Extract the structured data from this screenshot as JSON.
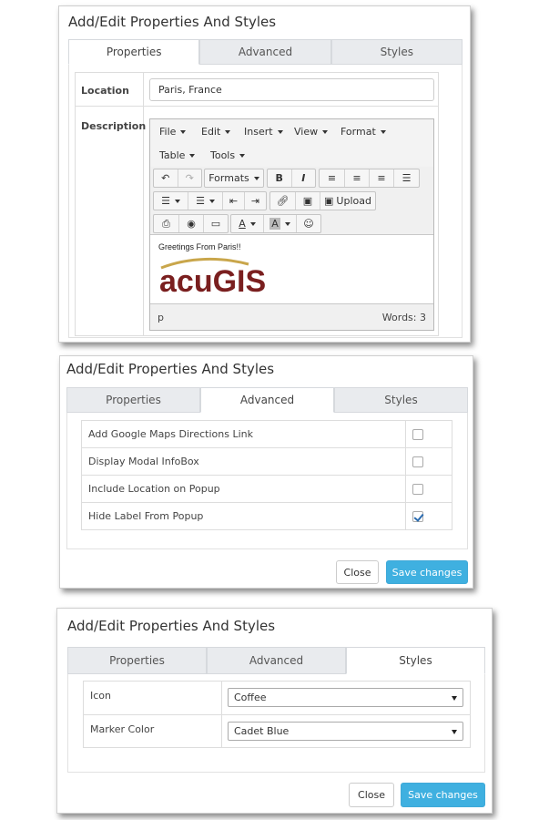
{
  "panel1": {
    "title": "Add/Edit Properties And Styles",
    "tabs": [
      "Properties",
      "Advanced",
      "Styles"
    ],
    "location_label": "Location",
    "location_value": "Paris, France",
    "description_label": "Description",
    "menus": [
      "File",
      "Edit",
      "Insert",
      "View",
      "Format",
      "Table",
      "Tools"
    ],
    "formats_label": "Formats",
    "upload_label": "Upload",
    "content_text": "Greetings From Paris!!",
    "logo_text": "acuGIS",
    "status_path": "p",
    "word_count": "Words: 3"
  },
  "panel2": {
    "title": "Add/Edit Properties And Styles",
    "tabs": [
      "Properties",
      "Advanced",
      "Styles"
    ],
    "options": [
      {
        "label": "Add Google Maps Directions Link",
        "checked": false
      },
      {
        "label": "Display Modal InfoBox",
        "checked": false
      },
      {
        "label": "Include Location on Popup",
        "checked": false
      },
      {
        "label": "Hide Label From Popup",
        "checked": true
      }
    ],
    "close_label": "Close",
    "save_label": "Save changes"
  },
  "panel3": {
    "title": "Add/Edit Properties And Styles",
    "tabs": [
      "Properties",
      "Advanced",
      "Styles"
    ],
    "icon_label": "Icon",
    "icon_value": "Coffee",
    "marker_label": "Marker Color",
    "marker_value": "Cadet Blue",
    "close_label": "Close",
    "save_label": "Save changes"
  },
  "colors": {
    "accent": "#3fb0e0",
    "logo_dark": "#7a1f1f",
    "logo_gold": "#c9a64b"
  }
}
